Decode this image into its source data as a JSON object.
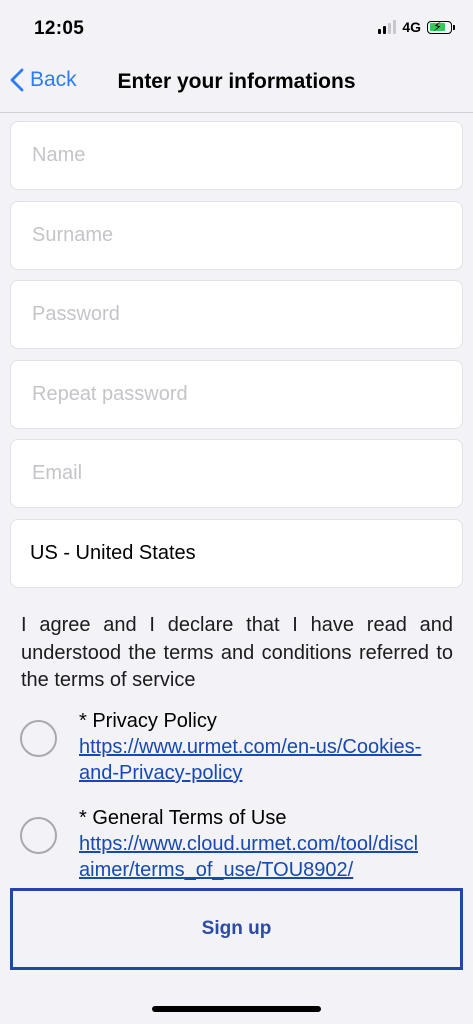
{
  "status": {
    "time": "12:05",
    "network": "4G"
  },
  "nav": {
    "back_label": "Back",
    "title": "Enter your informations"
  },
  "form": {
    "name_placeholder": "Name",
    "surname_placeholder": "Surname",
    "password_placeholder": "Password",
    "repeat_password_placeholder": "Repeat password",
    "email_placeholder": "Email",
    "country_value": "US - United States"
  },
  "terms": {
    "intro": "I agree and I declare that I have read and understood the terms and conditions referred to the terms of service",
    "privacy_title": "* Privacy Policy",
    "privacy_link": "https://www.urmet.com/en-us/Cookies-and-Privacy-policy",
    "terms_title": "* General Terms of Use",
    "terms_link": "https://www.cloud.urmet.com/tool/disclaimer/terms_of_use/TOU8902/"
  },
  "actions": {
    "signup_label": "Sign up"
  },
  "colors": {
    "accent": "#2f7bf5",
    "link": "#1849b3",
    "button_border": "#2445a8",
    "battery": "#34c759"
  }
}
